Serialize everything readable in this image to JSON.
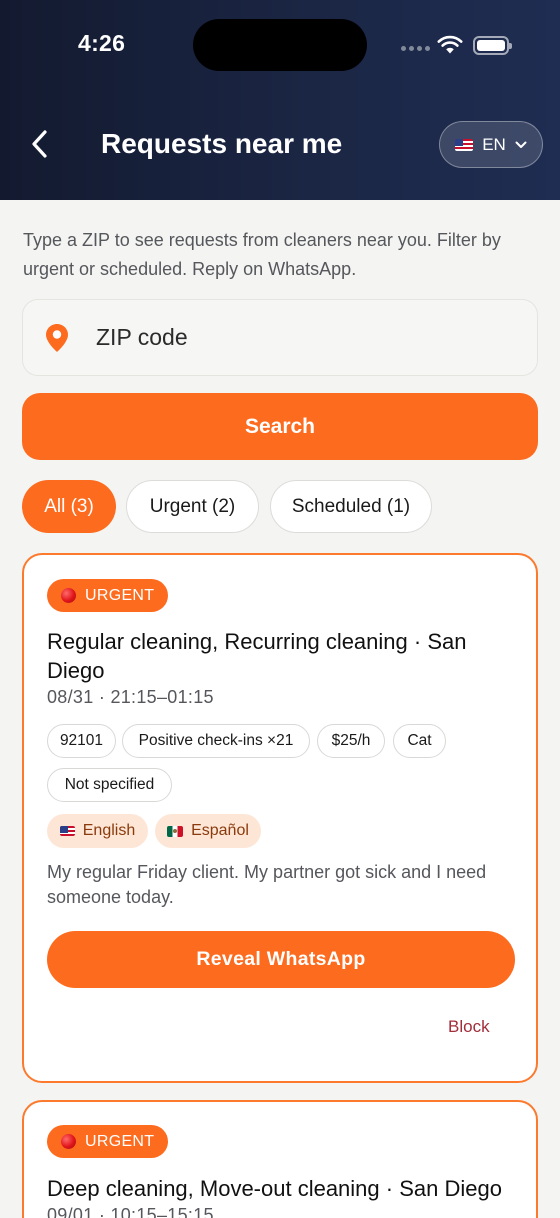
{
  "status_bar": {
    "time": "4:26"
  },
  "header": {
    "title": "Requests near me",
    "language": "EN"
  },
  "intro_text": "Type a ZIP to see requests from cleaners near you. Filter by urgent or scheduled. Reply on WhatsApp.",
  "search": {
    "placeholder": "ZIP code",
    "value": "",
    "button_label": "Search"
  },
  "filters": [
    {
      "label": "All (3)",
      "active": true
    },
    {
      "label": "Urgent (2)",
      "active": false
    },
    {
      "label": "Scheduled (1)",
      "active": false
    }
  ],
  "requests": [
    {
      "badge": "URGENT",
      "title": "Regular cleaning, Recurring cleaning · San Diego",
      "datetime": "08/31 · 21:15–01:15",
      "tags": [
        "92101",
        "Positive check-ins ×21",
        "$25/h",
        "Cat",
        "Not specified"
      ],
      "languages": [
        "English",
        "Español"
      ],
      "description": "My regular Friday client. My partner got sick and I need someone today.",
      "reveal_label": "Reveal WhatsApp",
      "block_label": "Block"
    },
    {
      "badge": "URGENT",
      "title": "Deep cleaning, Move-out cleaning · San Diego",
      "datetime": "09/01 · 10:15–15:15"
    }
  ],
  "colors": {
    "accent": "#fd6b1f",
    "header_bg": "#161e36",
    "block_link": "#a32d3a"
  },
  "icons": [
    "back-chevron-icon",
    "location-pin-icon",
    "wifi-icon",
    "battery-icon",
    "chevron-down-icon",
    "us-flag-icon",
    "mexico-flag-icon",
    "red-circle-icon"
  ]
}
